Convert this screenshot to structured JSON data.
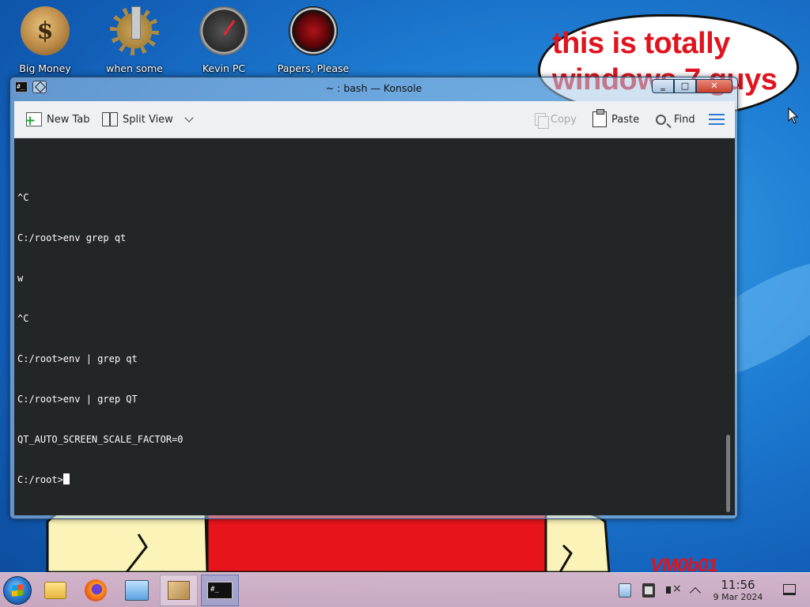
{
  "desktop": {
    "icons": [
      {
        "label": "Big Money",
        "icon": "money-bag-icon"
      },
      {
        "label": "when some",
        "icon": "gear-tower-icon"
      },
      {
        "label": "Kevin PC",
        "icon": "speed-gauge-icon"
      },
      {
        "label": "Papers, Please",
        "icon": "papers-please-icon"
      }
    ],
    "speech_bubble_text": "this is totally windows 7 guys",
    "signature": "VM0b01"
  },
  "window": {
    "title": "~ : bash — Konsole",
    "app_icon_text": "#_",
    "buttons": {
      "minimize": "‗",
      "maximize": "□",
      "close": "✕"
    }
  },
  "toolbar": {
    "new_tab": "New Tab",
    "split_view": "Split View",
    "copy": "Copy",
    "paste": "Paste",
    "find": "Find",
    "copy_enabled": false
  },
  "terminal": {
    "lines": [
      "^C",
      "C:/root>env grep qt",
      "w",
      "^C",
      "C:/root>env | grep qt",
      "C:/root>env | grep QT",
      "QT_AUTO_SCREEN_SCALE_FACTOR=0"
    ],
    "prompt": "C:/root>"
  },
  "taskbar": {
    "items": [
      {
        "icon": "folder-icon",
        "active": false
      },
      {
        "icon": "firefox-icon",
        "active": false
      },
      {
        "icon": "control-panel-icon",
        "active": false
      },
      {
        "icon": "package-box-icon",
        "active": true
      },
      {
        "icon": "terminal-icon",
        "active": true,
        "text": "#_"
      }
    ],
    "clock": {
      "time": "11:56",
      "date": "9 Mar 2024"
    }
  },
  "colors": {
    "accent": "#2a7bd3",
    "terminal_bg": "#232627",
    "speech_red": "#e0141e"
  }
}
